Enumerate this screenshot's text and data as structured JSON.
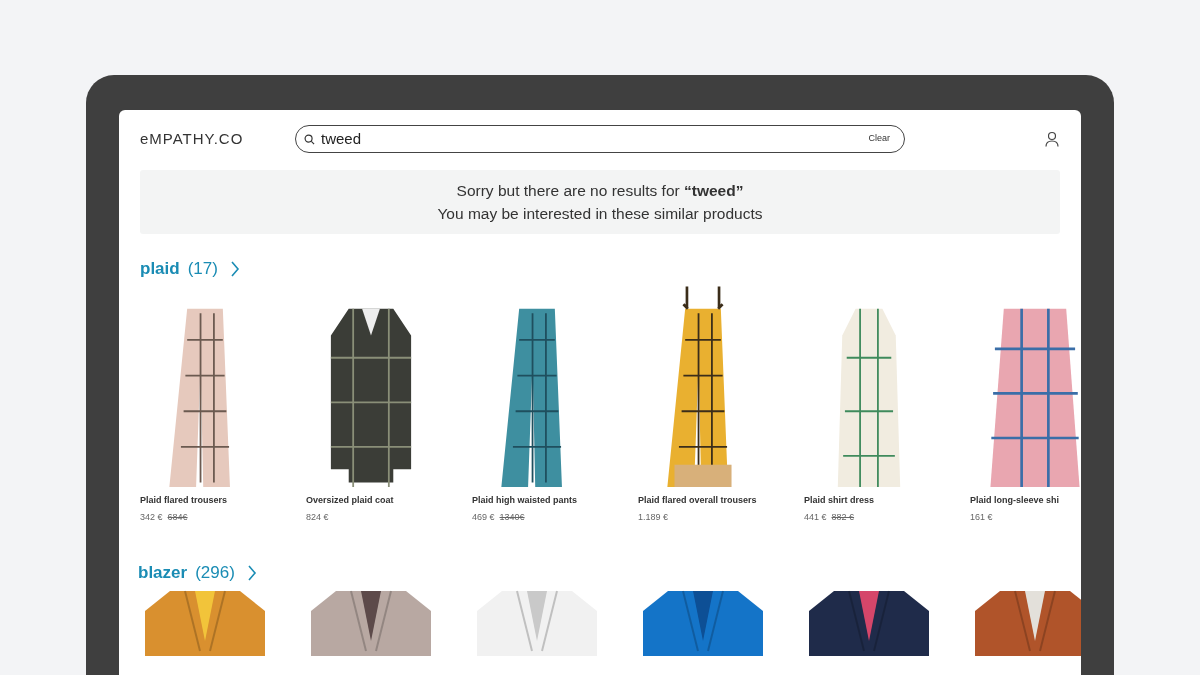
{
  "header": {
    "logo": "eMPATHY.CO",
    "search": {
      "value": "tweed",
      "clear": "Clear"
    }
  },
  "notice": {
    "line_1": "Sorry but there are no results for **“tweed”**",
    "line_2": "You may be interested in these similar products"
  },
  "sections": [
    {
      "title": "plaid",
      "count": "(17)",
      "products": [
        {
          "name": "Plaid flared trousers",
          "price": "342 €",
          "old_price": "684€"
        },
        {
          "name": "Oversized plaid coat",
          "price": "824 €"
        },
        {
          "name": "Plaid high waisted pants",
          "price": "469 €",
          "old_price": "1340€"
        },
        {
          "name": "Plaid flared overall trousers",
          "price": "1.189 €"
        },
        {
          "name": "Plaid shirt dress",
          "price": "441 €",
          "old_price": "882 €"
        },
        {
          "name": "Plaid long-sleeve shi",
          "price": "161 €"
        }
      ]
    },
    {
      "title": "blazer",
      "count": "(296)"
    }
  ]
}
